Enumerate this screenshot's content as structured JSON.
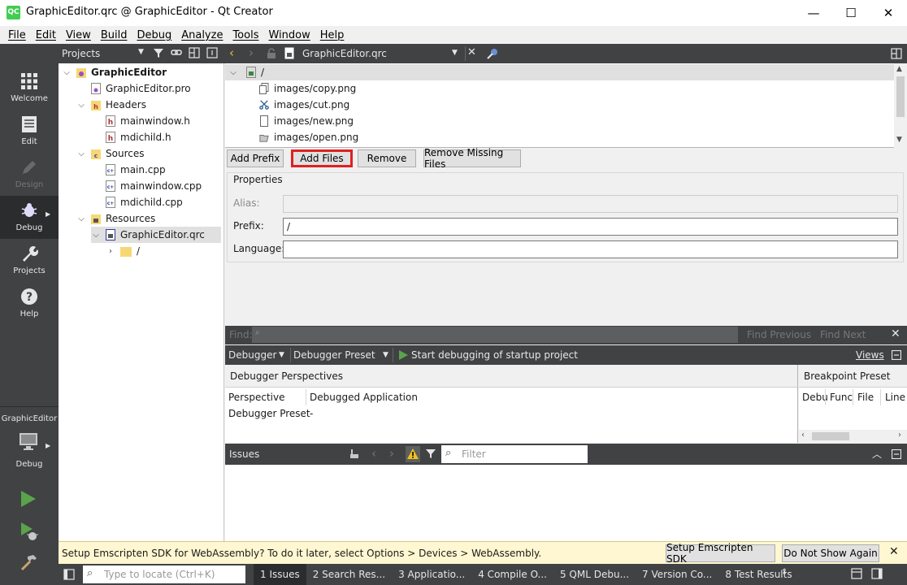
{
  "window": {
    "title": "GraphicEditor.qrc @ GraphicEditor - Qt Creator",
    "app_icon_text": "QC",
    "minimize": "—",
    "maximize": "☐",
    "close": "✕"
  },
  "menu": [
    "File",
    "Edit",
    "View",
    "Build",
    "Debug",
    "Analyze",
    "Tools",
    "Window",
    "Help"
  ],
  "modes": [
    {
      "label": "Welcome",
      "icon": "grid-icon"
    },
    {
      "label": "Edit",
      "icon": "document-icon"
    },
    {
      "label": "Design",
      "icon": "pen-icon"
    },
    {
      "label": "Debug",
      "icon": "bug-icon"
    },
    {
      "label": "Projects",
      "icon": "wrench-icon"
    },
    {
      "label": "Help",
      "icon": "help-icon"
    }
  ],
  "kit": {
    "project": "GraphicEditor",
    "mode": "Debug"
  },
  "projects_pane": {
    "title": "Projects",
    "tree": [
      {
        "label": "GraphicEditor",
        "bold": true
      },
      {
        "label": "GraphicEditor.pro"
      },
      {
        "label": "Headers"
      },
      {
        "label": "mainwindow.h"
      },
      {
        "label": "mdichild.h"
      },
      {
        "label": "Sources"
      },
      {
        "label": "main.cpp"
      },
      {
        "label": "mainwindow.cpp"
      },
      {
        "label": "mdichild.cpp"
      },
      {
        "label": "Resources"
      },
      {
        "label": "GraphicEditor.qrc"
      },
      {
        "label": "/"
      }
    ]
  },
  "editor": {
    "file_name": "GraphicEditor.qrc",
    "qrc_root": "/",
    "qrc_files": [
      "images/copy.png",
      "images/cut.png",
      "images/new.png",
      "images/open.png"
    ]
  },
  "buttons": {
    "add_prefix": "Add Prefix",
    "add_files": "Add Files",
    "remove": "Remove",
    "remove_missing": "Remove Missing Files"
  },
  "properties": {
    "heading": "Properties",
    "alias_label": "Alias:",
    "alias_value": "",
    "prefix_label": "Prefix:",
    "prefix_value": "/",
    "language_label": "Language:",
    "language_value": ""
  },
  "find": {
    "label": "Find:",
    "find_previous": "Find Previous",
    "find_next": "Find Next"
  },
  "debugger": {
    "debugger_combo": "Debugger",
    "preset_combo": "Debugger Preset",
    "start_label": "Start debugging of startup project",
    "views": "Views",
    "perspectives_title": "Debugger Perspectives",
    "rows": [
      {
        "key": "Perspective",
        "value": "Debugged Application"
      },
      {
        "key": "Debugger Preset",
        "value": "-"
      }
    ],
    "breakpoint_title": "Breakpoint Preset",
    "breakpoint_columns": [
      "Debu",
      "Func",
      "File",
      "Line"
    ]
  },
  "issues": {
    "title": "Issues",
    "filter_placeholder": "Filter"
  },
  "infobar": {
    "message": "Setup Emscripten SDK for WebAssembly? To do it later, select Options > Devices > WebAssembly.",
    "setup_button": "Setup Emscripten SDK",
    "dont_show_button": "Do Not Show Again"
  },
  "statusbar": {
    "locate_placeholder": "Type to locate (Ctrl+K)",
    "tabs": [
      "1  Issues",
      "2  Search Res...",
      "3  Applicatio...",
      "4  Compile O...",
      "5  QML Debu...",
      "7  Version Co...",
      "8  Test Results"
    ]
  }
}
